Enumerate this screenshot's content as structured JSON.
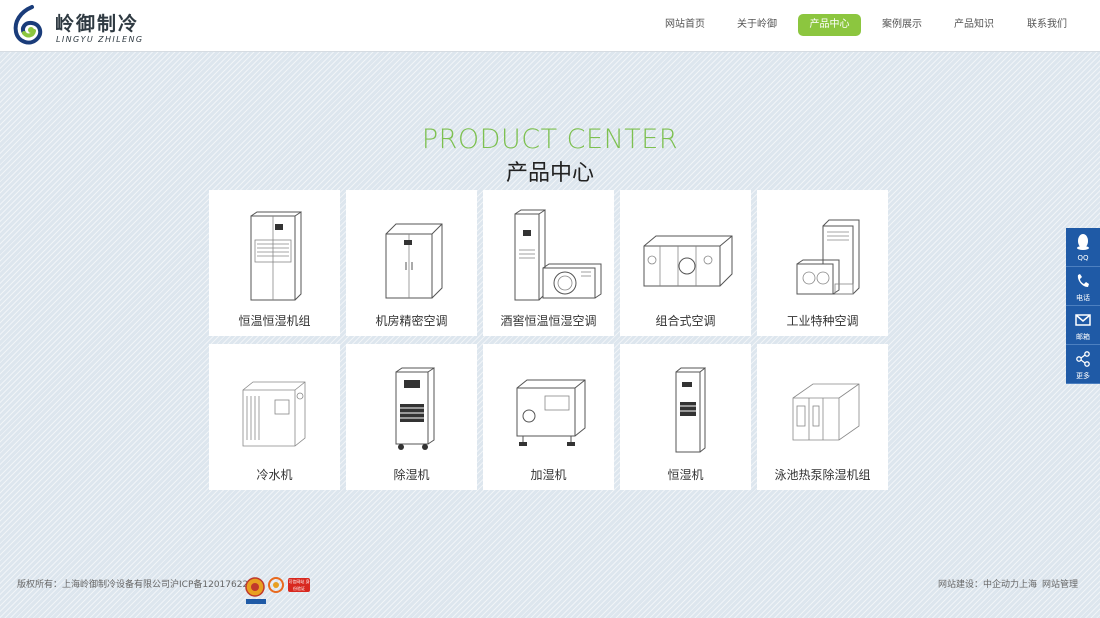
{
  "header": {
    "logo_cn": "岭御制冷",
    "logo_en": "LINGYU ZHILENG",
    "nav": [
      {
        "label": "网站首页",
        "active": false
      },
      {
        "label": "关于岭御",
        "active": false
      },
      {
        "label": "产品中心",
        "active": true
      },
      {
        "label": "案例展示",
        "active": false
      },
      {
        "label": "产品知识",
        "active": false
      },
      {
        "label": "联系我们",
        "active": false
      }
    ]
  },
  "section": {
    "title_en": "PRODUCT CENTER",
    "title_cn": "产品中心"
  },
  "products": [
    {
      "label": "恒温恒湿机组",
      "icon": "constant-temp-humidity-unit"
    },
    {
      "label": "机房精密空调",
      "icon": "precision-air-conditioner"
    },
    {
      "label": "酒窖恒温恒湿空调",
      "icon": "wine-cellar-ac"
    },
    {
      "label": "组合式空调",
      "icon": "modular-ac"
    },
    {
      "label": "工业特种空调",
      "icon": "industrial-ac"
    },
    {
      "label": "冷水机",
      "icon": "chiller"
    },
    {
      "label": "除湿机",
      "icon": "dehumidifier"
    },
    {
      "label": "加湿机",
      "icon": "humidifier"
    },
    {
      "label": "恒湿机",
      "icon": "constant-humidity-machine"
    },
    {
      "label": "泳池热泵除湿机组",
      "icon": "pool-heat-pump-dehumidifier"
    }
  ],
  "sidebar": [
    {
      "label": "QQ",
      "icon": "qq-icon"
    },
    {
      "label": "电话",
      "icon": "phone-icon"
    },
    {
      "label": "邮箱",
      "icon": "mail-icon"
    },
    {
      "label": "更多",
      "icon": "share-icon"
    }
  ],
  "footer": {
    "copyright": "版权所有：上海岭御制冷设备有限公司",
    "icp": "沪ICP备12017622号",
    "badge_text": "可信网站 身份验证",
    "build": "网站建设：中企动力上海",
    "admin": "网站管理"
  },
  "colors": {
    "accent": "#8cc63f",
    "sidebar": "#1f5aa6",
    "title_en": "#7dc050"
  }
}
